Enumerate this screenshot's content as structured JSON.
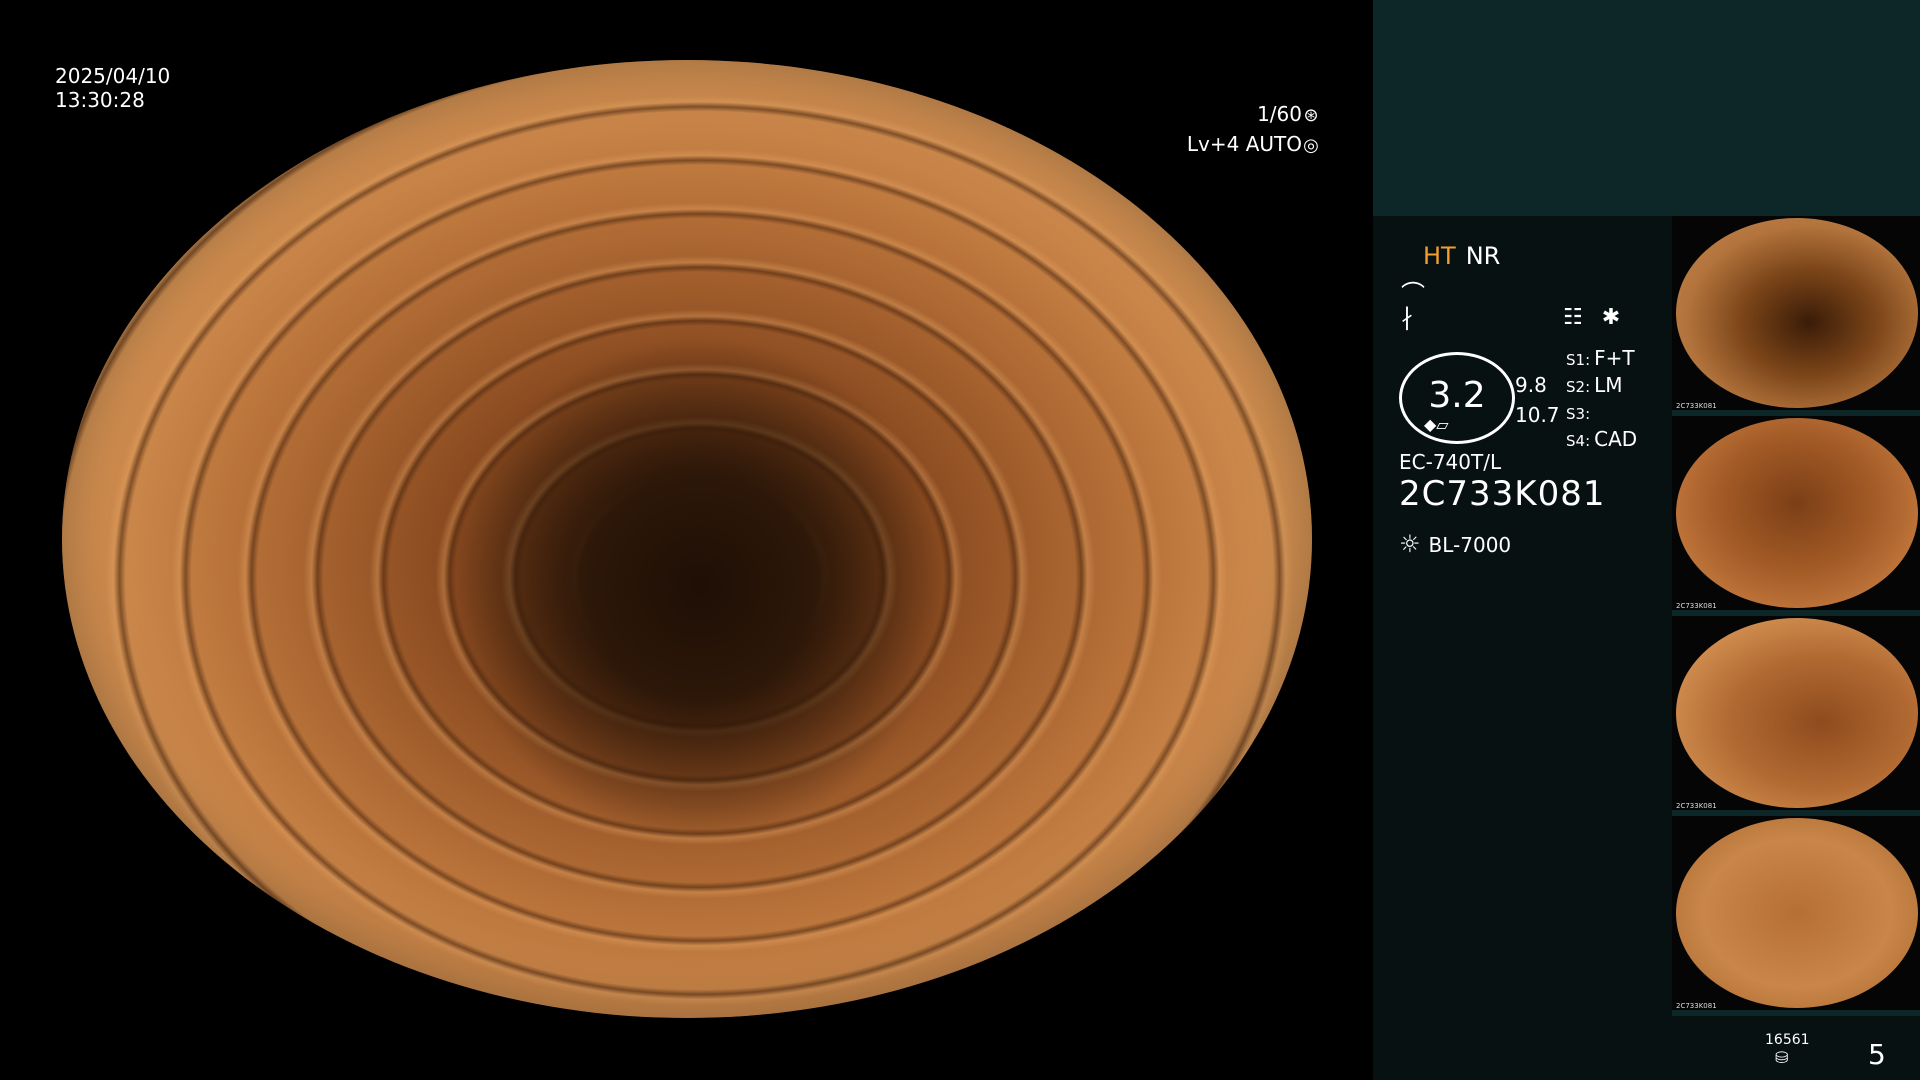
{
  "overlay": {
    "date": "2025/04/10",
    "time": "13:30:28",
    "shutter": "1/60",
    "level": "Lv+4 AUTO",
    "shutter_icon": "aperture-icon",
    "auto_icon": "iris-icon"
  },
  "status": {
    "ht": "HT",
    "nr": "NR",
    "icons": [
      "structure-enhance-icon",
      "color-mode-icon",
      "menu-icon",
      "asterisk-icon"
    ]
  },
  "zoom": {
    "value": "3.2",
    "side_top": "9.8",
    "side_bottom": "10.7"
  },
  "settings": [
    {
      "key": "S1:",
      "value": "F+T"
    },
    {
      "key": "S2:",
      "value": "LM"
    },
    {
      "key": "S3:",
      "value": ""
    },
    {
      "key": "S4:",
      "value": "CAD"
    }
  ],
  "scope": {
    "model": "EC-740T/L",
    "serial": "2C733K081"
  },
  "light_source": {
    "name": "BL-7000",
    "icon": "light-source-icon"
  },
  "thumbnails": [
    {
      "label": "2C733K081"
    },
    {
      "label": "2C733K081"
    },
    {
      "label": "2C733K081"
    },
    {
      "label": "2C733K081"
    }
  ],
  "counters": {
    "stored": "16561",
    "images": "5"
  },
  "colors": {
    "panel_bg": "#071111",
    "panel_top": "#0d2628",
    "ht_color": "#f0a030"
  }
}
